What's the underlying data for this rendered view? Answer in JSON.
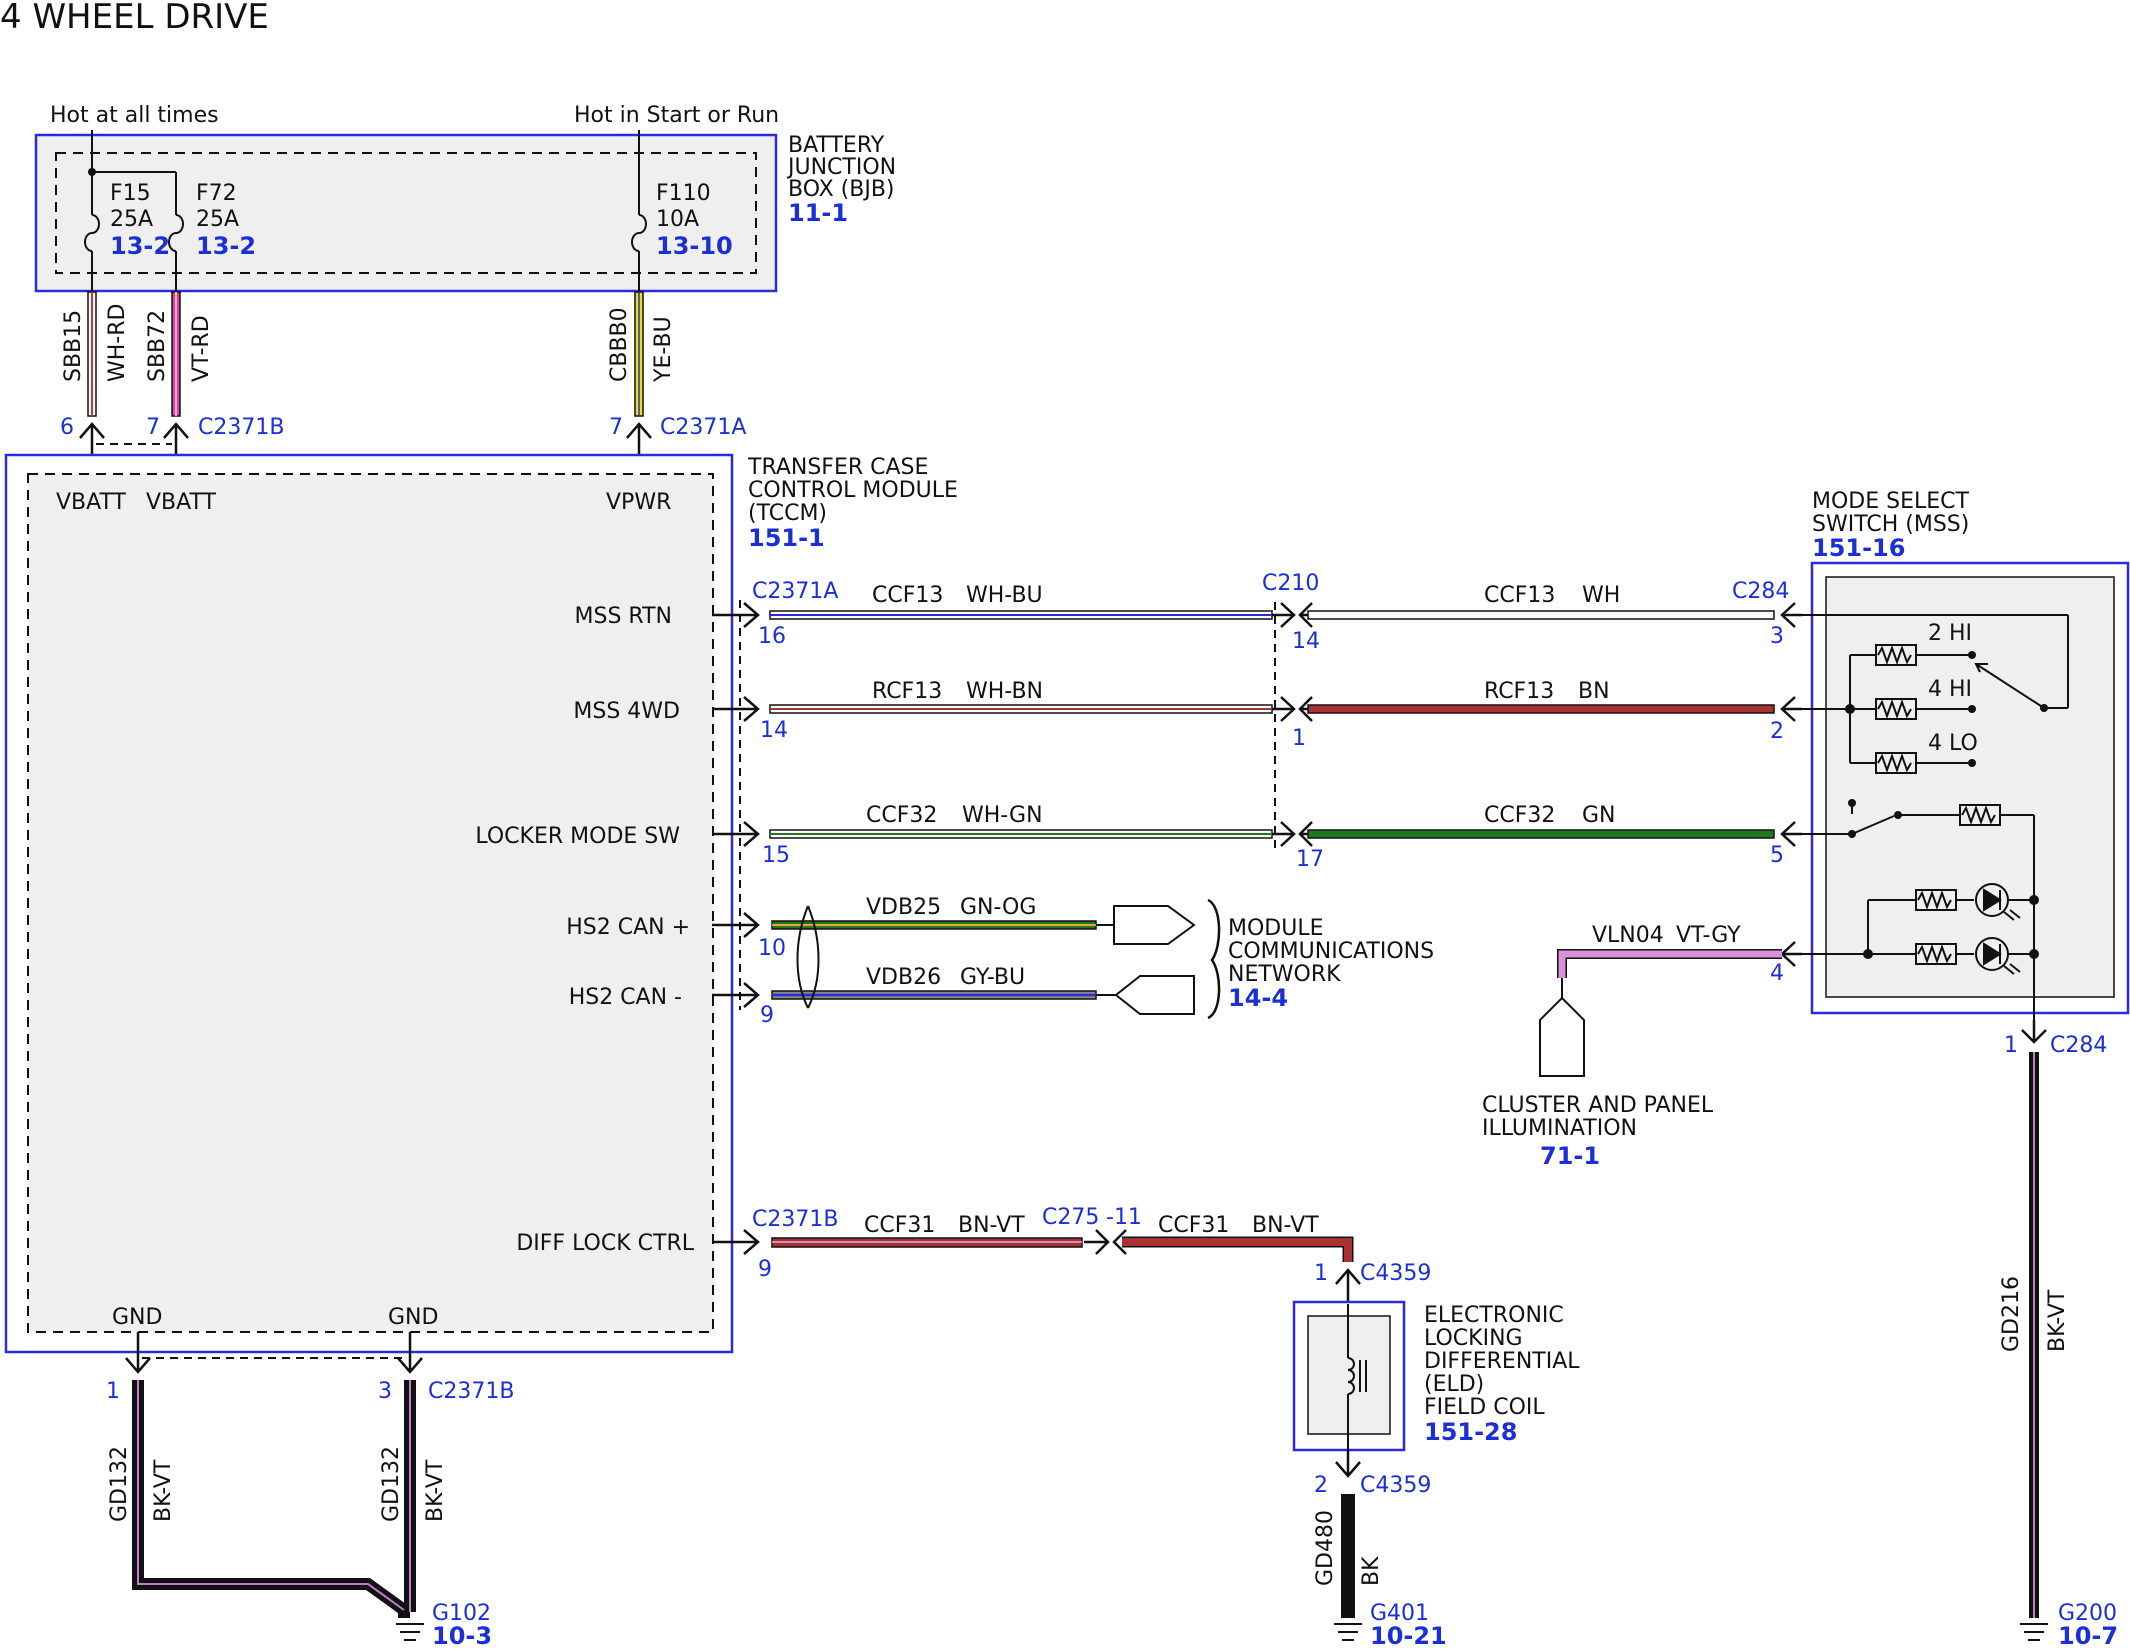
{
  "title": "4 WHEEL DRIVE",
  "colors": {
    "ref": "#1a2fd6",
    "box": "#2b2bd9",
    "fill": "#efefef",
    "bn": "#a83232",
    "gn": "#1f7a1f",
    "pink": "#e0409a",
    "yellow": "#e8e020",
    "bk": "#111111",
    "vt": "#c080c8"
  },
  "bjb": {
    "hot1": "Hot at all times",
    "hot2": "Hot in Start or Run",
    "name1": "BATTERY",
    "name2": "JUNCTION",
    "name3": "BOX (BJB)",
    "ref": "11-1",
    "fuses": [
      {
        "id": "F15",
        "amp": "25A",
        "ref": "13-2"
      },
      {
        "id": "F72",
        "amp": "25A",
        "ref": "13-2"
      },
      {
        "id": "F110",
        "amp": "10A",
        "ref": "13-10"
      }
    ]
  },
  "bjb_wires": [
    {
      "circuit": "SBB15",
      "color": "WH-RD",
      "pin": "6"
    },
    {
      "circuit": "SBB72",
      "color": "VT-RD",
      "pin": "7"
    },
    {
      "circuit": "CBBB0",
      "color": "YE-BU",
      "pin": "7"
    }
  ],
  "connectors": {
    "c2371b": "C2371B",
    "c2371a": "C2371A",
    "c210": "C210",
    "c284": "C284",
    "c275": "C275",
    "c275pin": "-11",
    "c4359": "C4359"
  },
  "tccm": {
    "name1": "TRANSFER CASE",
    "name2": "CONTROL MODULE",
    "name3": "(TCCM)",
    "ref": "151-1",
    "pins": {
      "vbatt1": "VBATT",
      "vbatt2": "VBATT",
      "vpwr": "VPWR",
      "mss_rtn": "MSS RTN",
      "mss_4wd": "MSS 4WD",
      "locker": "LOCKER MODE SW",
      "can_p": "HS2 CAN +",
      "can_m": "HS2 CAN -",
      "diff": "DIFF LOCK CTRL",
      "gnd1": "GND",
      "gnd2": "GND"
    }
  },
  "wires_left": [
    {
      "circuit": "CCF13",
      "color": "WH-BU",
      "pin": "16"
    },
    {
      "circuit": "RCF13",
      "color": "WH-BN",
      "pin": "14"
    },
    {
      "circuit": "CCF32",
      "color": "WH-GN",
      "pin": "15"
    },
    {
      "circuit": "VDB25",
      "color": "GN-OG",
      "pin": "10"
    },
    {
      "circuit": "VDB26",
      "color": "GY-BU",
      "pin": "9"
    }
  ],
  "wires_right": [
    {
      "circuit": "CCF13",
      "color": "WH",
      "pin_l": "14",
      "pin_r": "3"
    },
    {
      "circuit": "RCF13",
      "color": "BN",
      "pin_l": "1",
      "pin_r": "2"
    },
    {
      "circuit": "CCF32",
      "color": "GN",
      "pin_l": "17",
      "pin_r": "5"
    }
  ],
  "mcn": {
    "name1": "MODULE",
    "name2": "COMMUNICATIONS",
    "name3": "NETWORK",
    "ref": "14-4"
  },
  "mss": {
    "name1": "MODE SELECT",
    "name2": "SWITCH (MSS)",
    "ref": "151-16",
    "pos1": "2 HI",
    "pos2": "4 HI",
    "pos3": "4 LO"
  },
  "illum": {
    "circuit": "VLN04",
    "color": "VT-GY",
    "pin": "4",
    "name1": "CLUSTER AND PANEL",
    "name2": "ILLUMINATION",
    "ref": "71-1"
  },
  "mss_ground": {
    "pin": "1",
    "circuit": "GD216",
    "color": "BK-VT",
    "ground": "G200",
    "ref": "10-7"
  },
  "diff": {
    "pin": "9",
    "circuit1": "CCF31",
    "color1": "BN-VT",
    "circuit2": "CCF31",
    "color2": "BN-VT",
    "eld_pin1": "1",
    "eld_pin2": "2"
  },
  "eld": {
    "name1": "ELECTRONIC",
    "name2": "LOCKING",
    "name3": "DIFFERENTIAL",
    "name4": "(ELD)",
    "name5": "FIELD COIL",
    "ref": "151-28"
  },
  "eld_ground": {
    "circuit": "GD480",
    "color": "BK",
    "ground": "G401",
    "ref": "10-21"
  },
  "tccm_ground": {
    "pin1": "1",
    "pin2": "3",
    "circuit1": "GD132",
    "color1": "BK-VT",
    "circuit2": "GD132",
    "color2": "BK-VT",
    "ground": "G102",
    "ref": "10-3"
  }
}
